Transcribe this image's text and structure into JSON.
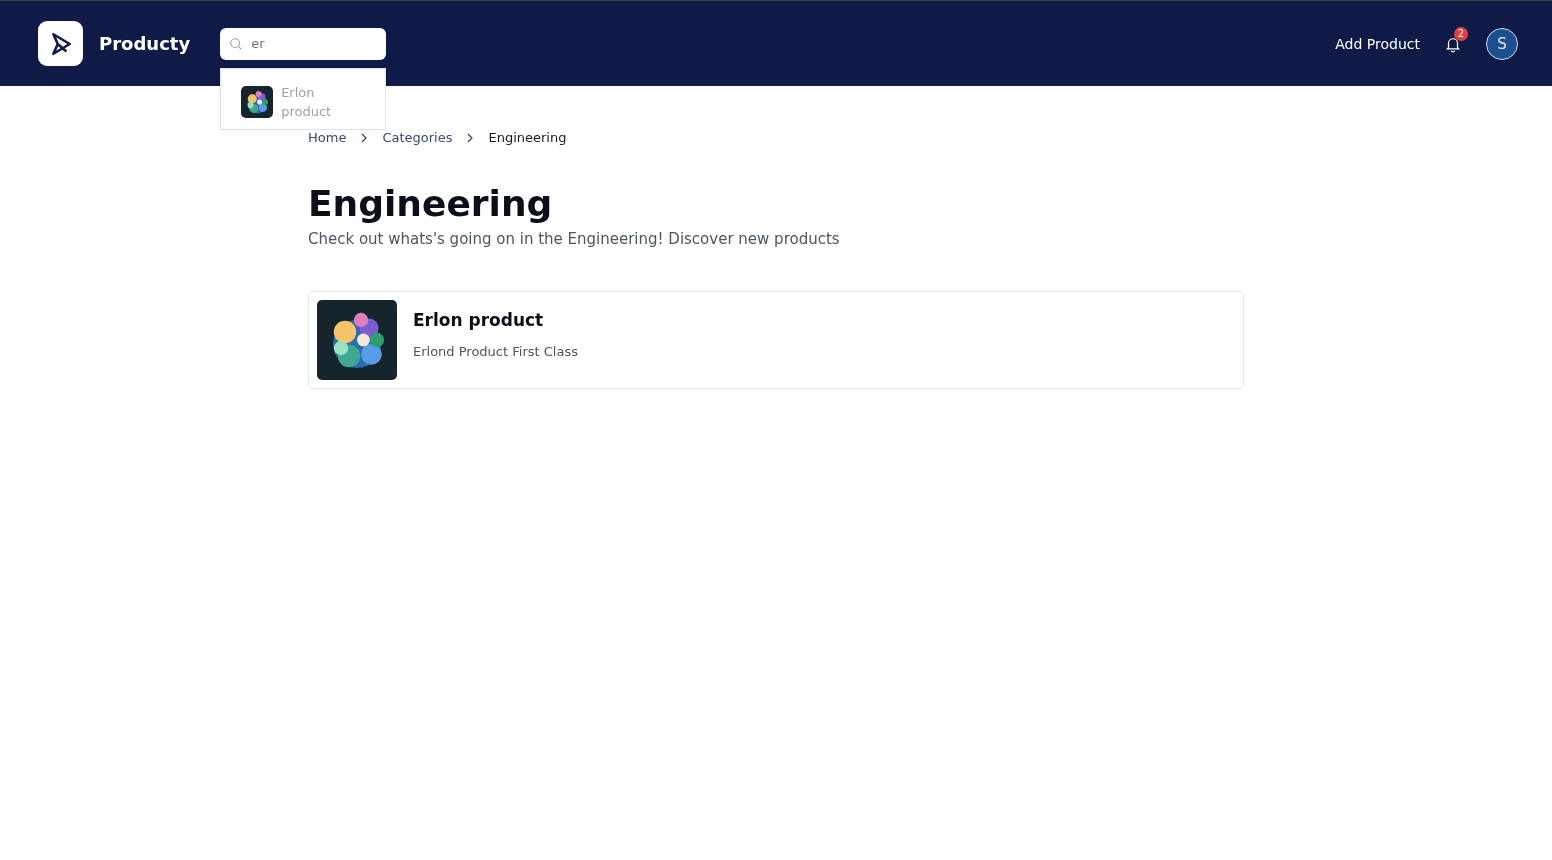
{
  "header": {
    "brand": "Producty",
    "search": {
      "value": "er",
      "results": [
        {
          "title": "Erlon product",
          "kind": "picture"
        }
      ]
    },
    "add_product": "Add Product",
    "notifications": {
      "count": "2"
    },
    "avatar": "S"
  },
  "breadcrumb": [
    {
      "label": "Home",
      "current": false
    },
    {
      "label": "Categories",
      "current": false
    },
    {
      "label": "Engineering",
      "current": true
    }
  ],
  "page": {
    "title": "Engineering",
    "subtitle": "Check out whats's going on in the Engineering! Discover new products"
  },
  "products": [
    {
      "name": "Erlon product",
      "description": "Erlond Product First Class",
      "kind": "picture"
    }
  ]
}
